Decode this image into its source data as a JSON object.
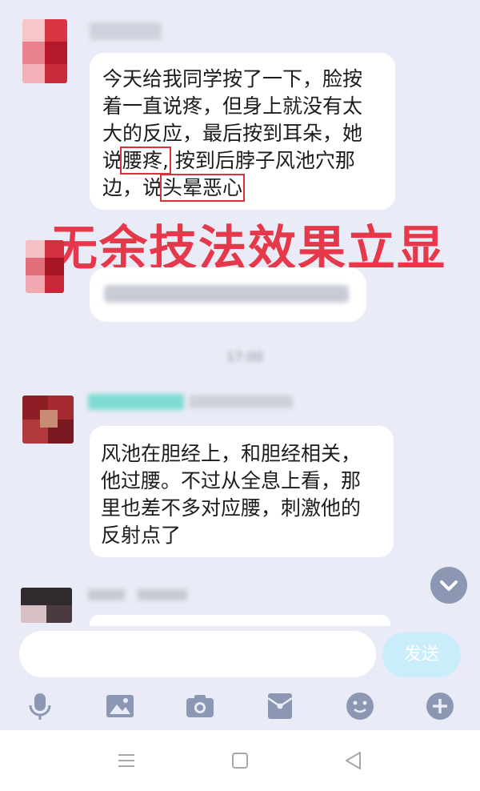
{
  "messages": {
    "first_text": {
      "before": "今天给我同学按了一下，脸按着一直说疼，但身上就没有太大的反应，最后按到耳朵，她说",
      "highlight1": "腰疼,",
      "middle": " 按到后脖子风池穴那边，说",
      "highlight2": "头晕恶心"
    },
    "reply_text": "风池在胆经上，和胆经相关，他过腰。不过从全息上看，那里也差不多对应腰，刺激他的反射点了",
    "time_label": "17:00"
  },
  "overlay_caption": "无余技法效果立显",
  "composer": {
    "send_label": "发送"
  },
  "icons": [
    "mic-icon",
    "image-icon",
    "camera-icon",
    "red-packet-icon",
    "emoji-icon",
    "plus-icon",
    "scroll-down-icon"
  ]
}
